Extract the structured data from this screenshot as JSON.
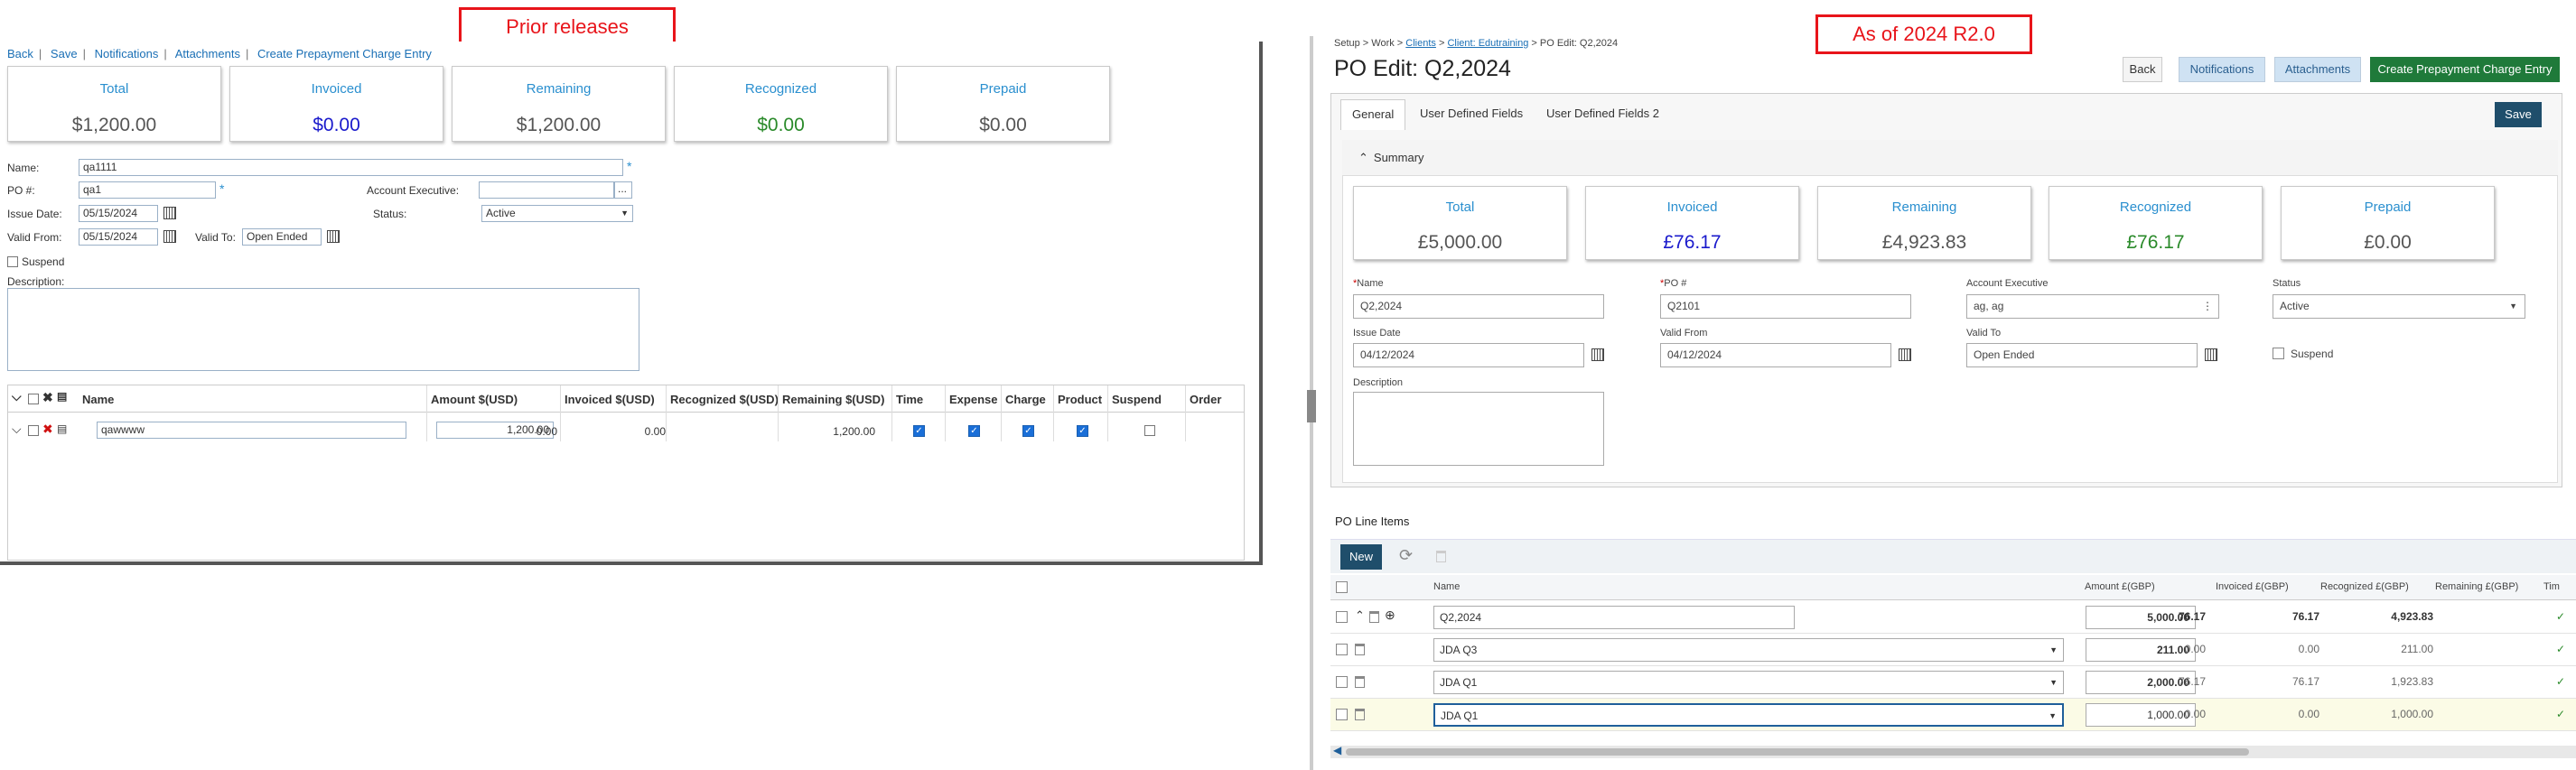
{
  "callouts": {
    "left": "Prior releases",
    "right": "As of 2024 R2.0"
  },
  "old": {
    "links": [
      "Back",
      "Save",
      "Notifications",
      "Attachments",
      "Create Prepayment Charge Entry"
    ],
    "cards": [
      {
        "title": "Total",
        "value": "$1,200.00",
        "color": "#555555"
      },
      {
        "title": "Invoiced",
        "value": "$0.00",
        "color": "#1a1acc"
      },
      {
        "title": "Remaining",
        "value": "$1,200.00",
        "color": "#555555"
      },
      {
        "title": "Recognized",
        "value": "$0.00",
        "color": "#2a8a2a"
      },
      {
        "title": "Prepaid",
        "value": "$0.00",
        "color": "#555555"
      }
    ],
    "form": {
      "name_label": "Name:",
      "name_value": "qa1111",
      "po_label": "PO #:",
      "po_value": "qa1",
      "ae_label": "Account Executive:",
      "ae_value": "",
      "issue_label": "Issue Date:",
      "issue_value": "05/15/2024",
      "status_label": "Status:",
      "status_value": "Active",
      "valid_from_label": "Valid From:",
      "valid_from_value": "05/15/2024",
      "valid_to_label": "Valid To:",
      "valid_to_value": "Open Ended",
      "suspend_label": "Suspend",
      "desc_label": "Description:",
      "ae_button": "..."
    },
    "grid": {
      "headers": [
        "Name",
        "Amount $(USD)",
        "Invoiced $(USD)",
        "Recognized $(USD)",
        "Remaining $(USD)",
        "Time",
        "Expense",
        "Charge",
        "Product",
        "Suspend",
        "Order"
      ],
      "row": {
        "name": "qawwww",
        "amount": "1,200.00",
        "invoiced": "0.00",
        "recognized": "0.00",
        "remaining": "1,200.00"
      }
    }
  },
  "new": {
    "breadcrumb": {
      "p1": "Setup > Work > ",
      "l1": "Clients",
      "p2": " > ",
      "l2": "Client: Edutraining",
      "p3": " > PO Edit: Q2,2024"
    },
    "title": "PO Edit: Q2,2024",
    "buttons": {
      "back": "Back",
      "notifications": "Notifications",
      "attachments": "Attachments",
      "prepay": "Create Prepayment Charge Entry",
      "save": "Save",
      "new": "New"
    },
    "tabs": [
      "General",
      "User Defined Fields",
      "User Defined Fields 2"
    ],
    "summary_label": "Summary",
    "cards": [
      {
        "title": "Total",
        "value": "£5,000.00",
        "color": "#555555"
      },
      {
        "title": "Invoiced",
        "value": "£76.17",
        "color": "#1a1acc"
      },
      {
        "title": "Remaining",
        "value": "£4,923.83",
        "color": "#555555"
      },
      {
        "title": "Recognized",
        "value": "£76.17",
        "color": "#2a8a2a"
      },
      {
        "title": "Prepaid",
        "value": "£0.00",
        "color": "#555555"
      }
    ],
    "form": {
      "name_label": "Name",
      "name_value": "Q2,2024",
      "po_label": "PO #",
      "po_value": "Q2101",
      "ae_label": "Account Executive",
      "ae_value": "ag, ag",
      "status_label": "Status",
      "status_value": "Active",
      "issue_label": "Issue Date",
      "issue_value": "04/12/2024",
      "valid_from_label": "Valid From",
      "valid_from_value": "04/12/2024",
      "valid_to_label": "Valid To",
      "valid_to_value": "Open Ended",
      "suspend_label": "Suspend",
      "desc_label": "Description"
    },
    "line_items_label": "PO Line Items",
    "grid": {
      "headers": [
        "Name",
        "Amount £(GBP)",
        "Invoiced £(GBP)",
        "Recognized £(GBP)",
        "Remaining £(GBP)",
        "Tim"
      ],
      "rows": [
        {
          "name": "Q2,2024",
          "amount": "5,000.00",
          "invoiced": "76.17",
          "recognized": "76.17",
          "remaining": "4,923.83"
        },
        {
          "name": "JDA Q3",
          "amount": "211.00",
          "invoiced": "0.00",
          "recognized": "0.00",
          "remaining": "211.00"
        },
        {
          "name": "JDA Q1",
          "amount": "2,000.00",
          "invoiced": "76.17",
          "recognized": "76.17",
          "remaining": "1,923.83"
        },
        {
          "name": "JDA Q1",
          "amount": "1,000.00",
          "invoiced": "0.00",
          "recognized": "0.00",
          "remaining": "1,000.00"
        }
      ]
    }
  }
}
